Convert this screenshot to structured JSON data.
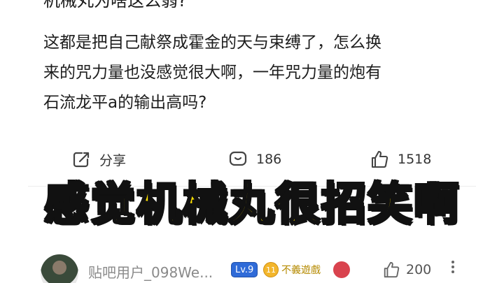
{
  "post": {
    "title_partial": "机械丸为啥这么弱?",
    "body_lines": [
      "这都是把自己献祭成霍金的天与束缚了，怎么换",
      "来的咒力量也没感觉很大啊，一年咒力量的炮有",
      "石流龙平a的输出高吗?"
    ],
    "actions": {
      "share_label": "分享",
      "comment_count": "186",
      "like_count": "1518"
    }
  },
  "overlay": {
    "caption": "感觉机械丸很招笑啊"
  },
  "comment": {
    "username": "贴吧用户_098We...",
    "level": "Lv.9",
    "fan_level": "11",
    "fan_title": "不義遊戲",
    "like_count": "200"
  },
  "colors": {
    "caption_fill": "#ffe100",
    "caption_stroke": "#111111",
    "level_badge": "#2f6bd8",
    "fan_coin": "#f3b62c"
  },
  "icons": [
    "share-icon",
    "comment-icon",
    "like-icon",
    "more-icon"
  ]
}
